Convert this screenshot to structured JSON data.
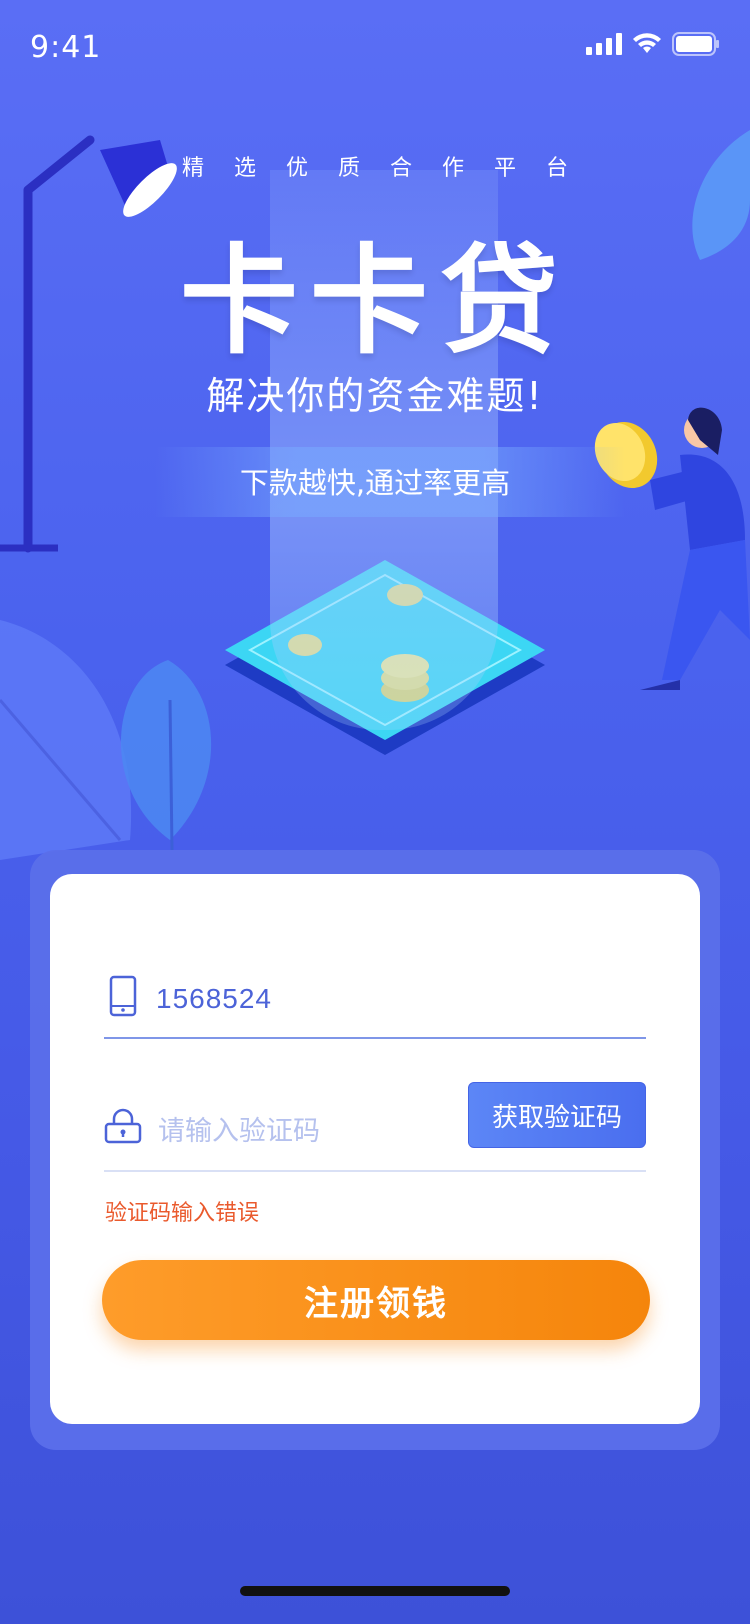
{
  "status_bar": {
    "time": "9:41"
  },
  "hero": {
    "tagline": "精选优质合作平台",
    "logo": "卡卡贷",
    "slogan": "解决你的资金难题!",
    "sub_slogan": "下款越快,通过率更高"
  },
  "form": {
    "phone_value": "1568524",
    "code_placeholder": "请输入验证码",
    "get_code_label": "获取验证码",
    "error_text": "验证码输入错误",
    "submit_label": "注册领钱"
  },
  "colors": {
    "brand_blue": "#4A62EE",
    "button_orange": "#F5850B",
    "error_red": "#EA5A2D"
  },
  "icons": [
    "signal-icon",
    "wifi-icon",
    "battery-icon",
    "phone-icon",
    "lock-icon"
  ]
}
